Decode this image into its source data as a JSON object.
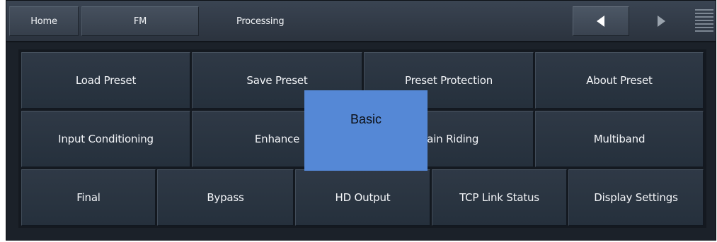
{
  "nav": {
    "home": "Home",
    "fm": "FM",
    "processing": "Processing"
  },
  "icons": {
    "back": "triangle-left-icon",
    "forward": "triangle-right-icon",
    "menu": "hamburger-icon"
  },
  "grid": {
    "row1": [
      "Load Preset",
      "Save Preset",
      "Preset Protection",
      "About Preset"
    ],
    "row2": [
      "Input Conditioning",
      "Enhance",
      "Gain Riding",
      "Multiband"
    ],
    "row3": [
      "Final",
      "Bypass",
      "HD Output",
      "TCP Link Status",
      "Display Settings"
    ]
  },
  "popup": {
    "label": "Basic"
  },
  "colors": {
    "background": "#1b2129",
    "button": "#2b3542",
    "text": "#f4f6f9",
    "popup": "#5588d6"
  }
}
